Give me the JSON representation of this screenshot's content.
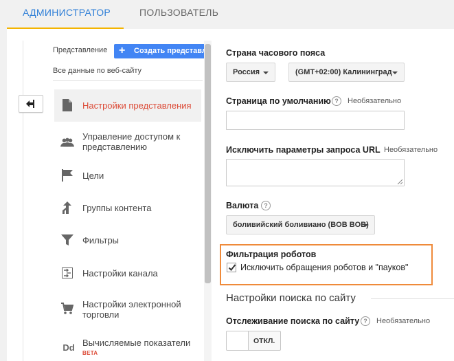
{
  "tabs": [
    {
      "label": "Администратор"
    },
    {
      "label": "Пользователь"
    }
  ],
  "colors": {
    "accent_blue": "#2f7fd7",
    "tab_underline": "#f4b400",
    "selected_text": "#dc4a36",
    "highlight_border": "#ef8a3a",
    "create_button": "#4285f4"
  },
  "sidebar": {
    "view_label": "Представление",
    "create_view_button": "Создать представление",
    "current_view": "Все данные по веб-сайту",
    "items": [
      {
        "label": "Настройки представления",
        "icon": "document-icon",
        "selected": true
      },
      {
        "label": "Управление доступом к представлению",
        "icon": "people-icon",
        "selected": false
      },
      {
        "label": "Цели",
        "icon": "flag-icon",
        "selected": false
      },
      {
        "label": "Группы контента",
        "icon": "merge-arrow-icon",
        "selected": false
      },
      {
        "label": "Фильтры",
        "icon": "filter-icon",
        "selected": false
      },
      {
        "label": "Настройки канала",
        "icon": "channel-settings-icon",
        "selected": false
      },
      {
        "label": "Настройки электронной торговли",
        "icon": "cart-icon",
        "selected": false
      },
      {
        "label": "Вычисляемые показатели",
        "icon": "dd-icon",
        "icon_text": "Dd",
        "badge": "BETA",
        "selected": false
      }
    ]
  },
  "form": {
    "timezone_country": {
      "label": "Страна часового пояса",
      "country_value": "Россия",
      "zone_value": "(GMT+02:00) Калининград"
    },
    "default_page": {
      "label": "Страница по умолчанию",
      "optional": "Необязательно",
      "help": "?",
      "value": ""
    },
    "exclude_params": {
      "label": "Исключить параметры запроса URL",
      "optional": "Необязательно",
      "value": ""
    },
    "currency": {
      "label": "Валюта",
      "help": "?",
      "value": "боливийский боливиано (BOB BOB)"
    },
    "bot_filtering": {
      "label": "Фильтрация роботов",
      "checkbox_label": "Исключить обращения роботов и \"пауков\"",
      "checked": true
    },
    "site_search": {
      "section_title": "Настройки поиска по сайту",
      "tracking_label": "Отслеживание поиска по сайту",
      "help": "?",
      "optional": "Необязательно",
      "toggle_label": "ОТКЛ.",
      "enabled": false
    }
  }
}
